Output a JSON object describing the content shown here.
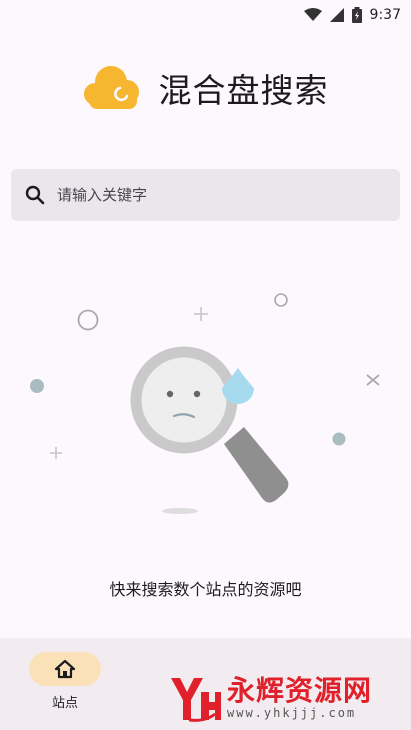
{
  "status_bar": {
    "time": "9:37",
    "icons": [
      "wifi-icon",
      "cell-signal-icon",
      "battery-icon"
    ]
  },
  "header": {
    "logo_icon": "cloud-logo-icon",
    "title": "混合盘搜索"
  },
  "search": {
    "placeholder": "请输入关键字",
    "value": "",
    "icon": "search-icon"
  },
  "empty_state": {
    "illustration": "sad-magnifier-illustration",
    "message": "快来搜索数个站点的资源吧"
  },
  "bottom_nav": {
    "items": [
      {
        "label": "站点",
        "icon": "home-icon",
        "active": true
      }
    ]
  },
  "watermark": {
    "text": "永辉资源网",
    "url": "www.yhkjjj.com"
  },
  "colors": {
    "background": "#fdf8fd",
    "accent": "#f6b630",
    "nav_active_pill": "#fbe1b8",
    "search_bg": "#ebe6eb",
    "watermark": "#e0202a"
  }
}
